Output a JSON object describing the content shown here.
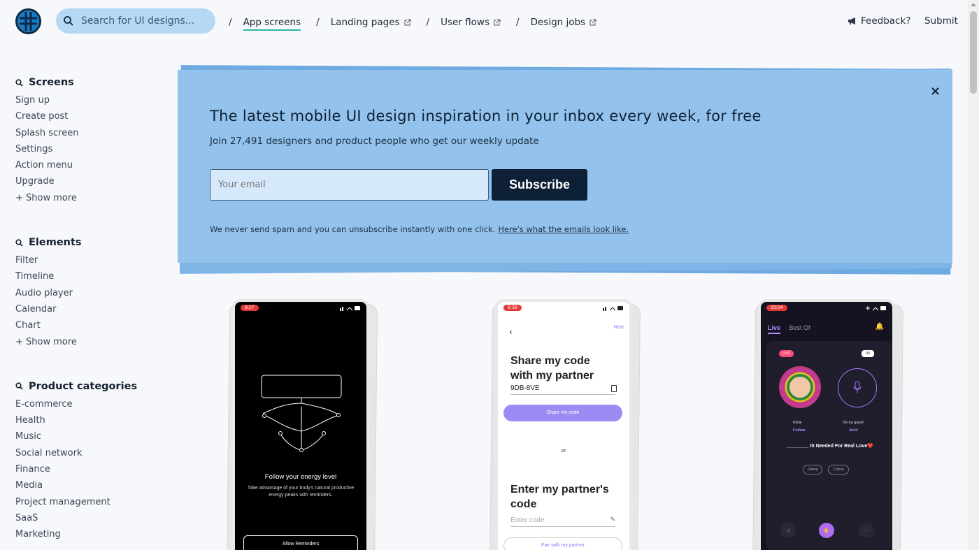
{
  "header": {
    "search_placeholder": "Search for UI designs...",
    "nav": [
      {
        "label": "App screens",
        "active": true
      },
      {
        "label": "Landing pages",
        "external": true
      },
      {
        "label": "User flows",
        "external": true
      },
      {
        "label": "Design jobs",
        "external": true
      }
    ],
    "separator": "/",
    "feedback": "Feedback?",
    "submit": "Submit"
  },
  "sidebar": {
    "screens": {
      "title": "Screens",
      "items": [
        "Sign up",
        "Create post",
        "Splash screen",
        "Settings",
        "Action menu",
        "Upgrade"
      ],
      "more": "+ Show more"
    },
    "elements": {
      "title": "Elements",
      "items": [
        "Filter",
        "Timeline",
        "Audio player",
        "Calendar",
        "Chart"
      ],
      "more": "+ Show more"
    },
    "categories": {
      "title": "Product categories",
      "items": [
        "E-commerce",
        "Health",
        "Music",
        "Social network",
        "Finance",
        "Media",
        "Project management",
        "SaaS",
        "Marketing"
      ]
    }
  },
  "banner": {
    "title": "The latest mobile UI design inspiration in your inbox every week, for free",
    "subtitle": "Join 27,491 designers and product people who get our weekly update",
    "email_placeholder": "Your email",
    "subscribe": "Subscribe",
    "note": "We never send spam and you can unsubscribe instantly with one click.",
    "note_link": "Here's what the emails look like.",
    "close": "×"
  },
  "screens": [
    {
      "time": "8:27",
      "title": "Follow your energy level",
      "desc": "Take advantage of your body's natural productive energy peaks with reminders.",
      "button": "Allow Reminders"
    },
    {
      "time": "6:39",
      "next": "Next",
      "heading": "Share my code with my partner",
      "code": "9DB-8VE",
      "share_button": "Share my code",
      "or": "or",
      "heading2": "Enter my partner's code",
      "enter_placeholder": "Enter code",
      "pair_button": "Pair with my partner"
    },
    {
      "time": "15:04",
      "tab_live": "Live",
      "tab_best": "Best Of",
      "badge": "LIVE",
      "count": "40",
      "name1": "Kimie",
      "name2": "Be my guest!",
      "follow": "Follow",
      "join": "Join!",
      "topic": "________ IS Needed For Real Love❤️",
      "chips": [
        "Dating",
        "Culture"
      ]
    }
  ],
  "colors": {
    "banner_bg": "#93c3ec",
    "accent_teal": "#2db5a3",
    "dark_navy": "#0d2035",
    "search_bg": "#b6d8f5"
  }
}
